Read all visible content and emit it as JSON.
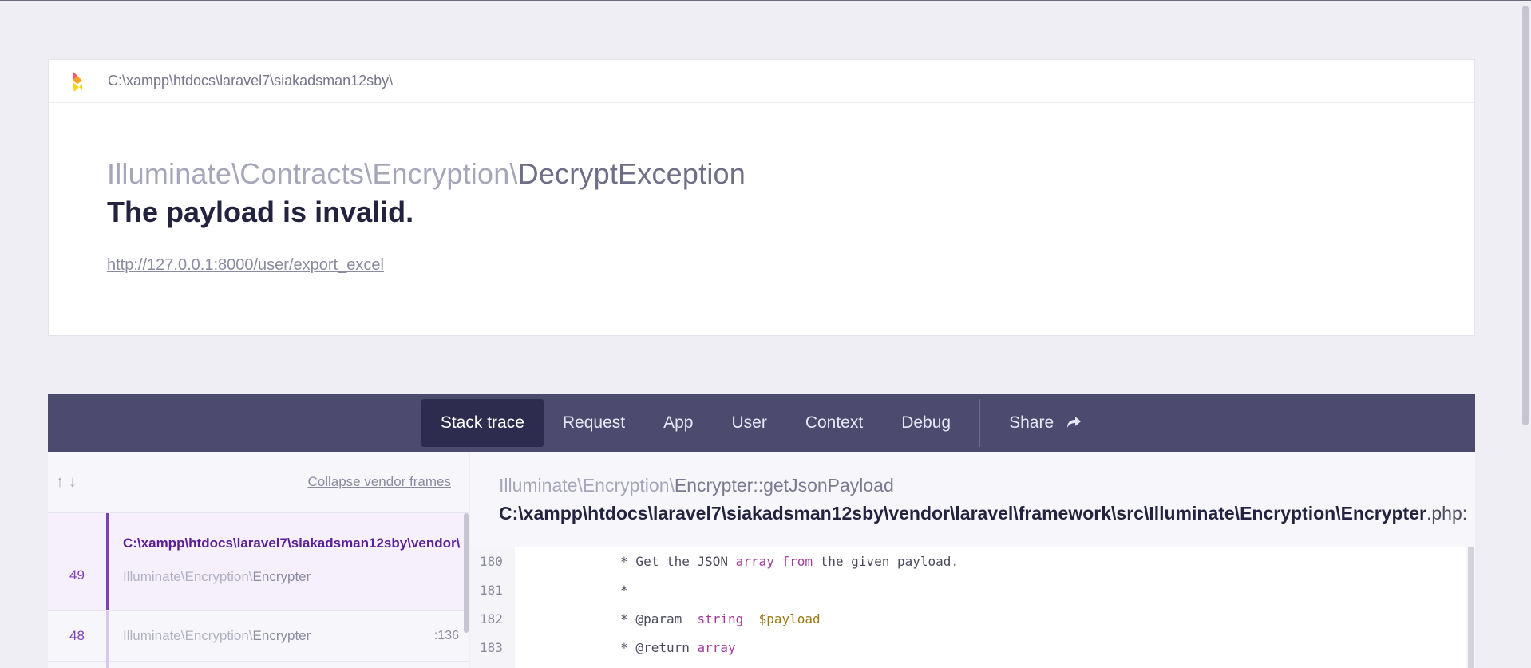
{
  "header": {
    "app_path": "C:\\xampp\\htdocs\\laravel7\\siakadsman12sby\\",
    "exception_namespace": "Illuminate\\Contracts\\Encryption\\",
    "exception_short": "DecryptException",
    "message": "The payload is invalid.",
    "url": "http://127.0.0.1:8000/user/export_excel"
  },
  "tabs": [
    {
      "label": "Stack trace",
      "active": true
    },
    {
      "label": "Request",
      "active": false
    },
    {
      "label": "App",
      "active": false
    },
    {
      "label": "User",
      "active": false
    },
    {
      "label": "Context",
      "active": false
    },
    {
      "label": "Debug",
      "active": false
    }
  ],
  "share": {
    "label": "Share",
    "icon": "share-arrow-icon"
  },
  "stack": {
    "collapse_label": "Collapse vendor frames",
    "frames": [
      {
        "number": "49",
        "file": "C:\\xampp\\htdocs\\laravel7\\siakadsman12sby\\vendor\\",
        "class_namespace": "Illuminate\\Encryption\\",
        "class_short": "Encrypter",
        "line": ""
      },
      {
        "number": "48",
        "file": "",
        "class_namespace": "Illuminate\\Encryption\\",
        "class_short": "Encrypter",
        "line": ":136"
      }
    ]
  },
  "detail": {
    "namespace": "Illuminate\\Encryption\\",
    "method": "Encrypter::getJsonPayload",
    "file_path": "C:\\xampp\\htdocs\\laravel7\\siakadsman12sby\\vendor\\laravel\\framework\\src\\Illuminate\\Encryption\\Encrypter",
    "file_ext": ".php:",
    "code": [
      {
        "line": "180",
        "pre": "     * Get the JSON ",
        "kw": "array",
        "mid": " ",
        "kw2": "from",
        "post": " the given payload."
      },
      {
        "line": "181",
        "pre": "     *",
        "kw": "",
        "mid": "",
        "kw2": "",
        "post": ""
      },
      {
        "line": "182",
        "pre": "     * @param  ",
        "kw": "string",
        "mid": "  ",
        "var": "$payload",
        "post": ""
      },
      {
        "line": "183",
        "pre": "     * @return ",
        "kw": "array",
        "mid": "",
        "kw2": "",
        "post": ""
      }
    ]
  },
  "colors": {
    "tab_bar": "#4c4a6e",
    "tab_active": "#2e2c4e",
    "frame_accent": "#7d3fb5",
    "page_bg": "#eeeef4"
  }
}
